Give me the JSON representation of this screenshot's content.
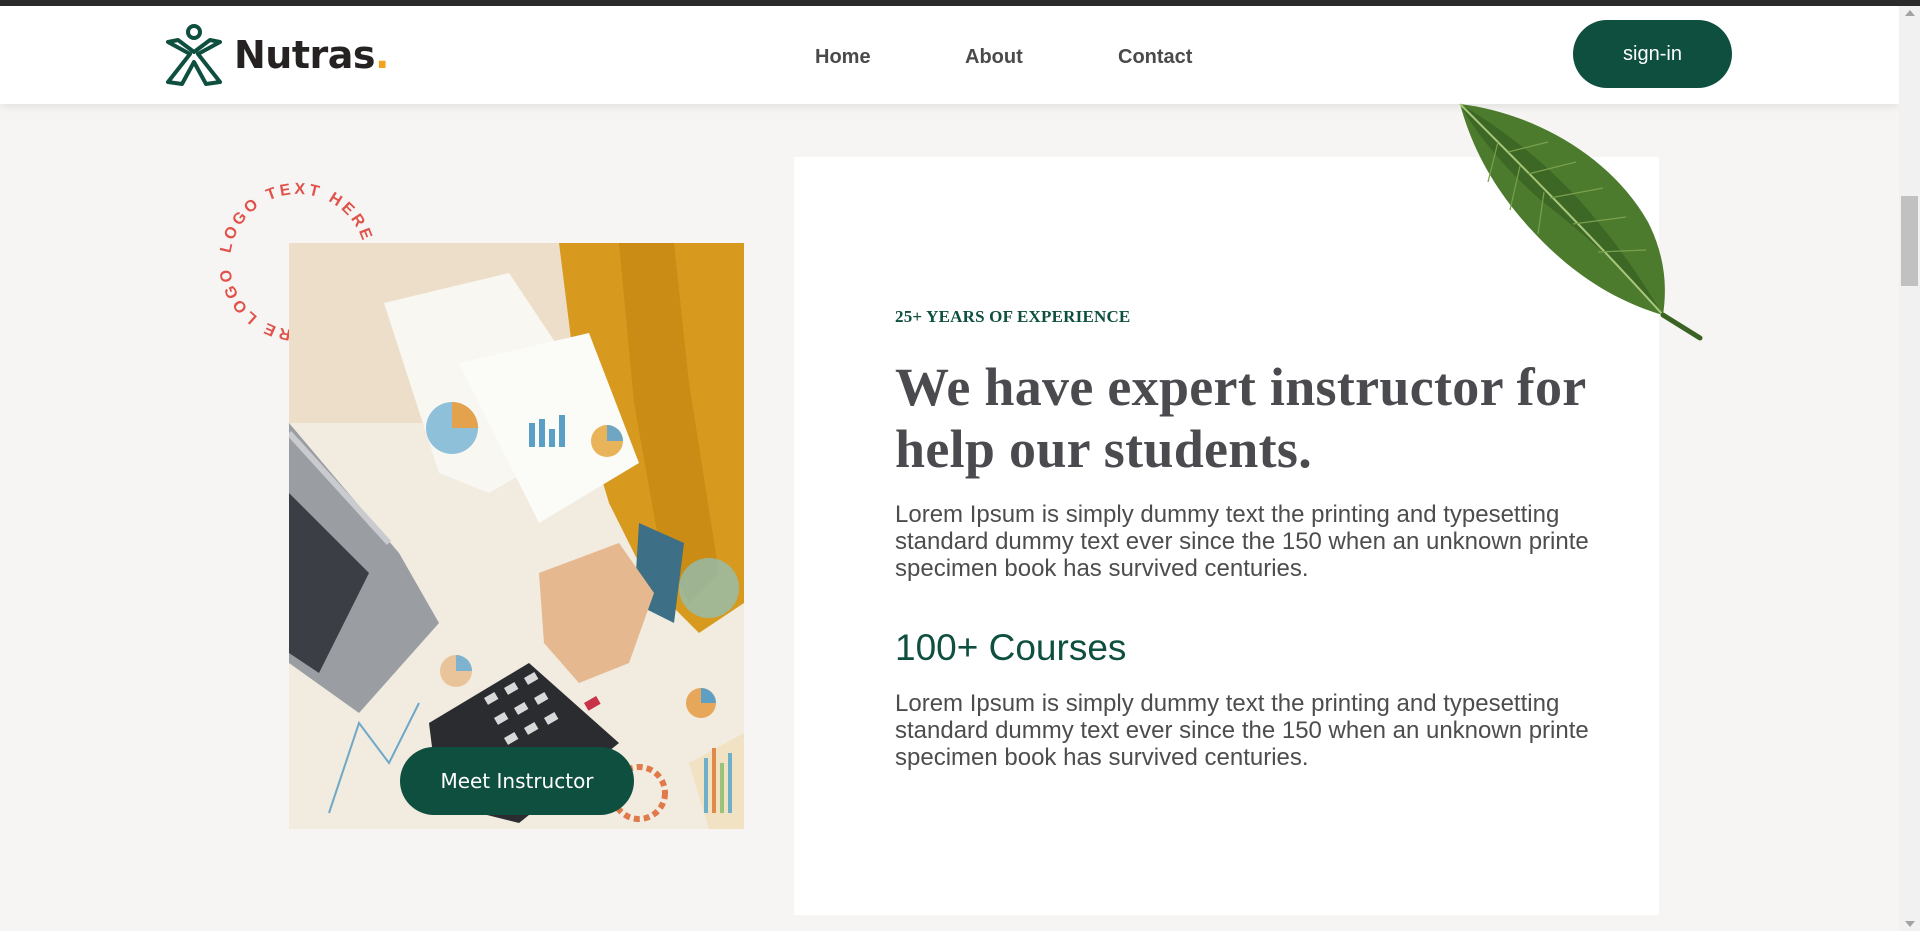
{
  "brand": {
    "name": "Nutras",
    "dot": ".",
    "logo_color": "#0e4f3f",
    "accent": "#f2a21f"
  },
  "nav": {
    "items": [
      {
        "label": "Home"
      },
      {
        "label": "About"
      },
      {
        "label": "Contact"
      }
    ]
  },
  "header": {
    "signin_label": "sign-in"
  },
  "badge": {
    "circle_text": "LOGO TEXT HERE SLOGAN HERE LOGO "
  },
  "hero": {
    "cta_label": "Meet Instructor"
  },
  "content": {
    "eyebrow": "25+ YEARS OF EXPERIENCE",
    "headline": "We have expert instructor for help our students.",
    "paragraph_1": "Lorem Ipsum is simply dummy text the printing and typesetting standard dummy text ever since the 150 when an unknown printe specimen book has survived centuries.",
    "courses_heading": "100+ Courses",
    "paragraph_2": "Lorem Ipsum is simply dummy text the printing and typesetting standard dummy text ever since the 150 when an unknown printe specimen book has survived centuries."
  },
  "colors": {
    "primary": "#0e4f3f",
    "heading_gray": "#4a4a4f",
    "badge_red": "#e0524a",
    "page_bg": "#f6f5f3"
  }
}
